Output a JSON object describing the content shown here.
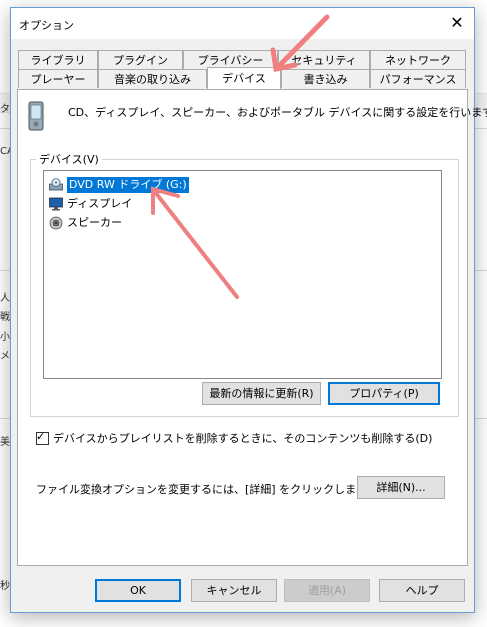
{
  "window": {
    "title": "オプション"
  },
  "tabs_row1": [
    "ライブラリ",
    "プラグイン",
    "プライバシー",
    "セキュリティ",
    "ネットワーク"
  ],
  "tabs_row2": [
    "プレーヤー",
    "音楽の取り込み",
    "デバイス",
    "書き込み",
    "パフォーマンス"
  ],
  "active_tab": "デバイス",
  "description": "CD、ディスプレイ、スピーカー、およびポータブル デバイスに関する設定を行います。",
  "devices": {
    "label": "デバイス(V)",
    "items": [
      {
        "label": "DVD RW ドライブ (G:)",
        "icon": "dvd-drive-icon",
        "selected": true
      },
      {
        "label": "ディスプレイ",
        "icon": "monitor-icon",
        "selected": false
      },
      {
        "label": "スピーカー",
        "icon": "speaker-icon",
        "selected": false
      }
    ],
    "refresh_label": "最新の情報に更新(R)",
    "properties_label": "プロパティ(P)"
  },
  "checkbox": {
    "label": "デバイスからプレイリストを削除するときに、そのコンテンツも削除する(D)",
    "checked": true
  },
  "conversion": {
    "text": "ファイル変換オプションを変更するには、[詳細] をクリックします。",
    "button_label": "詳細(N)..."
  },
  "footer": {
    "ok": "OK",
    "cancel": "キャンセル",
    "apply": "適用(A)",
    "help": "ヘルプ"
  },
  "background_fragments": [
    "タ",
    "CA",
    "人",
    "戦",
    "小",
    "メイ",
    "美",
    "秒"
  ],
  "colors": {
    "selection": "#0078d7",
    "annotation_arrow": "#f08080"
  }
}
